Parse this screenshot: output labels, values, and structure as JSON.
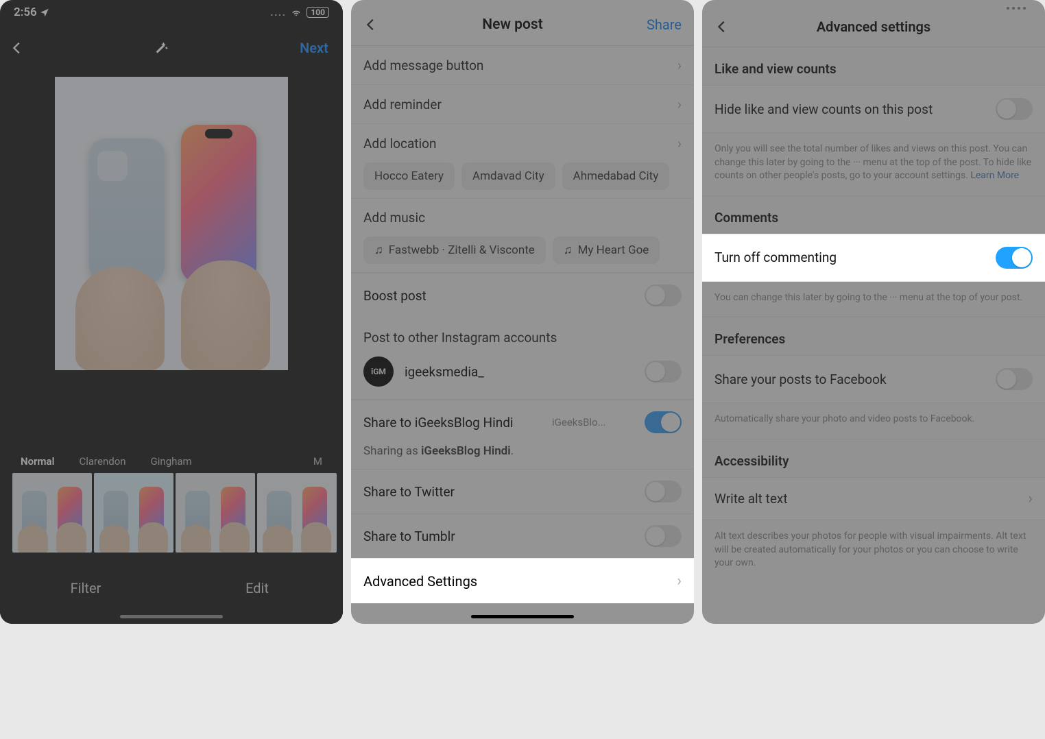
{
  "screen1": {
    "status": {
      "time": "2:56",
      "battery": "100"
    },
    "nav": {
      "next": "Next"
    },
    "filters": {
      "normal": "Normal",
      "clarendon": "Clarendon",
      "gingham": "Gingham",
      "partial": "M"
    },
    "tabs": {
      "filter": "Filter",
      "edit": "Edit"
    }
  },
  "screen2": {
    "nav": {
      "title": "New post",
      "share": "Share"
    },
    "rows": {
      "add_message": "Add message button",
      "add_reminder": "Add reminder",
      "add_location": "Add location",
      "add_music": "Add music",
      "boost": "Boost post"
    },
    "location_chips": [
      "Hocco Eatery",
      "Amdavad City",
      "Ahmedabad City"
    ],
    "music_chips": [
      "Fastwebb · Zitelli & Visconte",
      "My Heart Goe"
    ],
    "other_accounts_label": "Post to other Instagram accounts",
    "account_handle": "igeeksmedia_",
    "share_hindi": {
      "label": "Share to iGeeksBlog Hindi",
      "sub": "iGeeksBlo..."
    },
    "sharing_as_prefix": "Sharing as ",
    "sharing_as_name": "iGeeksBlog Hindi",
    "sharing_as_suffix": ".",
    "share_twitter": "Share to Twitter",
    "share_tumblr": "Share to Tumblr",
    "advanced": "Advanced Settings"
  },
  "screen3": {
    "nav": {
      "title": "Advanced settings"
    },
    "sections": {
      "likes_h": "Like and view counts",
      "hide_likes": "Hide like and view counts on this post",
      "hide_likes_desc_1": "Only you will see the total number of likes and views on this post. You can change this later by going to the ··· menu at the top of the post. To hide like counts on other people's posts, go to your account settings. ",
      "learn_more": "Learn More",
      "comments_h": "Comments",
      "turn_off": "Turn off commenting",
      "turn_off_desc": "You can change this later by going to the ··· menu at the top of your post.",
      "prefs_h": "Preferences",
      "share_fb": "Share your posts to Facebook",
      "share_fb_desc": "Automatically share your photo and video posts to Facebook.",
      "access_h": "Accessibility",
      "alt_text": "Write alt text",
      "alt_desc": "Alt text describes your photos for people with visual impairments. Alt text will be created automatically for your photos or you can choose to write your own."
    }
  }
}
